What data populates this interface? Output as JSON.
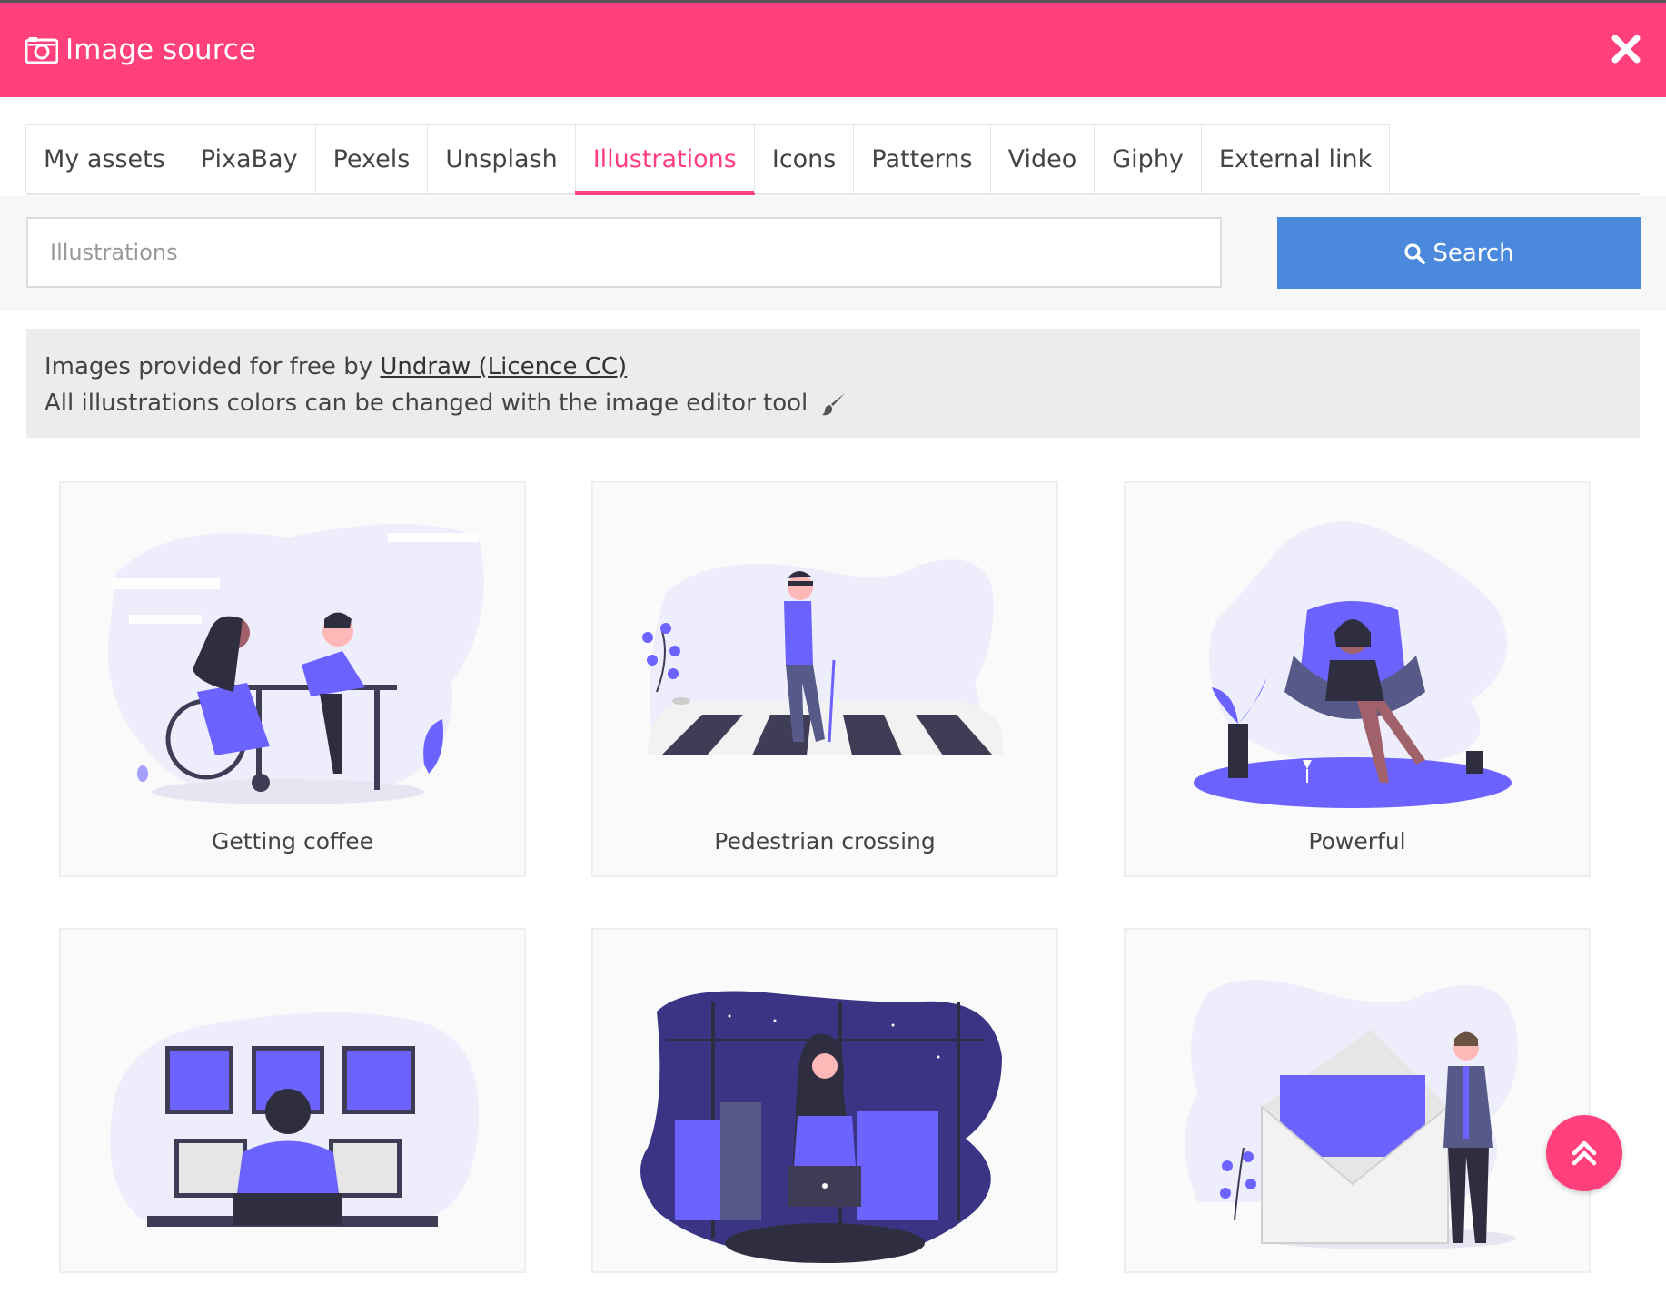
{
  "header": {
    "title": "Image source",
    "camera_icon": "camera-icon",
    "close_icon": "close-icon"
  },
  "tabs": [
    {
      "label": "My assets",
      "active": false
    },
    {
      "label": "PixaBay",
      "active": false
    },
    {
      "label": "Pexels",
      "active": false
    },
    {
      "label": "Unsplash",
      "active": false
    },
    {
      "label": "Illustrations",
      "active": true
    },
    {
      "label": "Icons",
      "active": false
    },
    {
      "label": "Patterns",
      "active": false
    },
    {
      "label": "Video",
      "active": false
    },
    {
      "label": "Giphy",
      "active": false
    },
    {
      "label": "External link",
      "active": false
    }
  ],
  "search": {
    "placeholder": "Illustrations",
    "value": "",
    "button_label": "Search",
    "icon": "search-icon"
  },
  "notice": {
    "line1_prefix": "Images provided for free by ",
    "link_text": "Undraw (Licence CC)",
    "line2": "All illustrations colors can be changed with the image editor tool",
    "brush_icon": "paint-brush-icon"
  },
  "cards": [
    {
      "label": "Getting coffee"
    },
    {
      "label": "Pedestrian crossing"
    },
    {
      "label": "Powerful"
    },
    {
      "label": ""
    },
    {
      "label": ""
    },
    {
      "label": ""
    }
  ],
  "colors": {
    "brand": "#ff407c",
    "search_button": "#4a89dc",
    "illustration_primary": "#6c63ff",
    "illustration_bg": "#eeedfb"
  },
  "fab": {
    "icon": "chevron-double-up-icon"
  }
}
